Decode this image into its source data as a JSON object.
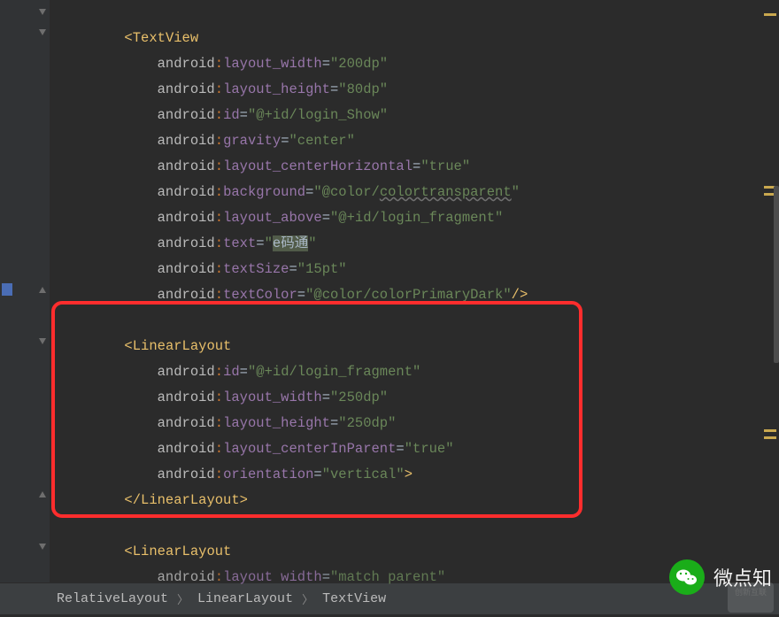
{
  "code": {
    "tag_open": "<",
    "tag_close": ">",
    "tag_selfclose": "/>",
    "tag_endopen": "</",
    "textview": "TextView",
    "linearlayout": "LinearLayout",
    "ns": "android",
    "colon": ":",
    "eq": "=",
    "attrs": {
      "layout_width": "layout_width",
      "layout_height": "layout_height",
      "id": "id",
      "gravity": "gravity",
      "layout_centerHorizontal": "layout_centerHorizontal",
      "background": "background",
      "layout_above": "layout_above",
      "text": "text",
      "textSize": "textSize",
      "textColor": "textColor",
      "layout_centerInParent": "layout_centerInParent",
      "orientation": "orientation",
      "layout_width2": "layout width"
    },
    "vals": {
      "w200": "\"200dp\"",
      "h80": "\"80dp\"",
      "idshow": "\"@+id/login_Show\"",
      "center": "\"center\"",
      "true": "\"true\"",
      "bg": "\"@color/",
      "bgname": "colortransparent",
      "bgend": "\"",
      "above": "\"@+id/login_fragment\"",
      "textq": "\"",
      "textval": "e码通",
      "size": "\"15pt\"",
      "color": "\"@color/colorPrimaryDark\"",
      "idfrag": "\"@+id/login_fragment\"",
      "w250": "\"250dp\"",
      "h250": "\"250dp\"",
      "vertical": "\"vertical\"",
      "matchp": "\"match parent\""
    }
  },
  "breadcrumb": {
    "a": "RelativeLayout",
    "b": "LinearLayout",
    "c": "TextView"
  },
  "watermark": "微点知"
}
